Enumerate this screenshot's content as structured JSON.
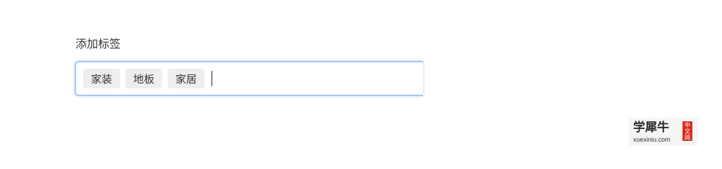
{
  "form": {
    "label": "添加标签"
  },
  "tags": [
    {
      "text": "家装"
    },
    {
      "text": "地板"
    },
    {
      "text": "家居"
    }
  ],
  "input": {
    "value": ""
  },
  "watermark": {
    "name": "学犀牛",
    "seal_chars": [
      "中",
      "文",
      "网"
    ],
    "domain": "xuexiniu.com"
  },
  "colors": {
    "focus_border": "#a9c6ef",
    "tag_background": "#eeeeee",
    "seal_red": "#d92b1f"
  }
}
